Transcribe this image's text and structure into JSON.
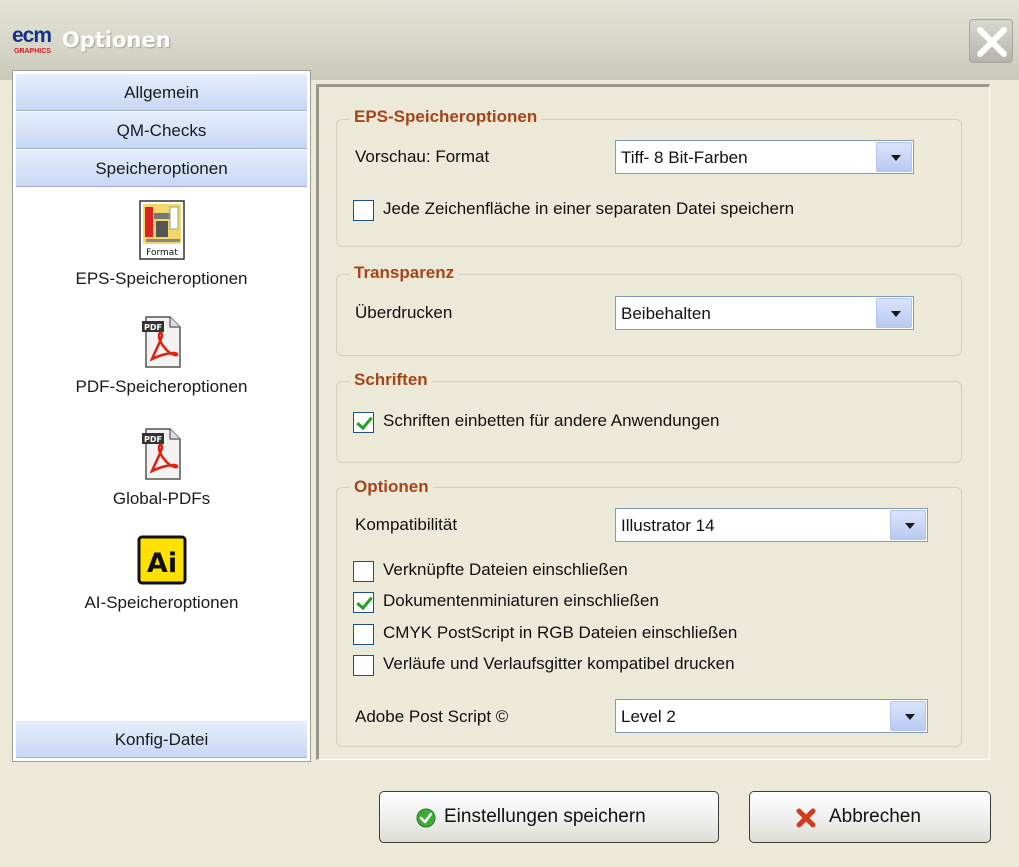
{
  "window": {
    "logo_text": "ecm",
    "logo_sub": "GRAPHICS",
    "title": "Optionen"
  },
  "nav": {
    "tabs": [
      {
        "label": "Allgemein"
      },
      {
        "label": "QM-Checks"
      },
      {
        "label": "Speicheroptionen"
      }
    ],
    "items": [
      {
        "label": "EPS-Speicheroptionen",
        "icon": "eps-format-icon"
      },
      {
        "label": "PDF-Speicheroptionen",
        "icon": "pdf-icon"
      },
      {
        "label": "Global-PDFs",
        "icon": "pdf-icon"
      },
      {
        "label": "AI-Speicheroptionen",
        "icon": "illustrator-icon"
      }
    ],
    "bottom_tab": {
      "label": "Konfig-Datei"
    }
  },
  "eps_group": {
    "title": "EPS-Speicheroptionen",
    "preview_label": "Vorschau: Format",
    "preview_value": "Tiff- 8 Bit-Farben",
    "separate_files_label": "Jede Zeichenfläche in einer separaten Datei speichern",
    "separate_files_checked": false
  },
  "transparency_group": {
    "title": "Transparenz",
    "overprint_label": "Überdrucken",
    "overprint_value": "Beibehalten"
  },
  "fonts_group": {
    "title": "Schriften",
    "embed_label": "Schriften einbetten für andere Anwendungen",
    "embed_checked": true
  },
  "options_group": {
    "title": "Optionen",
    "compat_label": "Kompatibilität",
    "compat_value": "Illustrator 14",
    "checkboxes": [
      {
        "label": "Verknüpfte Dateien einschließen",
        "checked": false
      },
      {
        "label": "Dokumentenminiaturen einschließen",
        "checked": true
      },
      {
        "label": "CMYK PostScript in RGB Dateien einschließen",
        "checked": false
      },
      {
        "label": "Verläufe und Verlaufsgitter kompatibel drucken",
        "checked": false
      }
    ],
    "postscript_label": "Adobe Post Script ©",
    "postscript_value": "Level 2"
  },
  "buttons": {
    "save_label": "Einstellungen speichern",
    "cancel_label": "Abbrechen"
  },
  "colors": {
    "group_title": "#a4451a",
    "tab_bg": "#c7d7f4",
    "window_bg": "#ece9d8",
    "check_green": "#21a121",
    "cancel_red": "#d23c1e"
  }
}
